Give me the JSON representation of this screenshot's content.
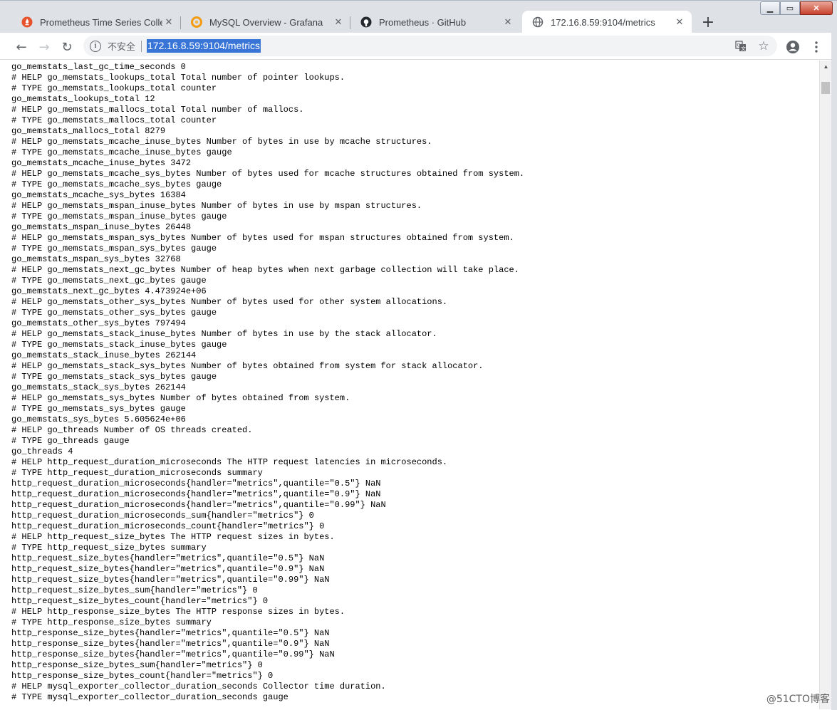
{
  "tabs": [
    {
      "title": "Prometheus Time Series Collec",
      "icon": "prometheus-flame-icon",
      "active": false
    },
    {
      "title": "MySQL Overview - Grafana",
      "icon": "grafana-icon",
      "active": false
    },
    {
      "title": "Prometheus · GitHub",
      "icon": "github-icon",
      "active": false
    },
    {
      "title": "172.16.8.59:9104/metrics",
      "icon": "globe-icon",
      "active": true
    }
  ],
  "new_tab_label": "+",
  "window_controls": {
    "minimize": "▁",
    "maximize": "▭",
    "close": "✕"
  },
  "toolbar": {
    "back": "←",
    "forward": "→",
    "reload": "↻",
    "info": "i",
    "insecure_label": "不安全",
    "url": "172.16.8.59:9104/metrics",
    "translate_icon": "translate-icon",
    "star_icon": "star-icon",
    "account_icon": "account-icon",
    "menu_icon": "menu-icon"
  },
  "metrics_lines": [
    "go_memstats_last_gc_time_seconds 0",
    "# HELP go_memstats_lookups_total Total number of pointer lookups.",
    "# TYPE go_memstats_lookups_total counter",
    "go_memstats_lookups_total 12",
    "# HELP go_memstats_mallocs_total Total number of mallocs.",
    "# TYPE go_memstats_mallocs_total counter",
    "go_memstats_mallocs_total 8279",
    "# HELP go_memstats_mcache_inuse_bytes Number of bytes in use by mcache structures.",
    "# TYPE go_memstats_mcache_inuse_bytes gauge",
    "go_memstats_mcache_inuse_bytes 3472",
    "# HELP go_memstats_mcache_sys_bytes Number of bytes used for mcache structures obtained from system.",
    "# TYPE go_memstats_mcache_sys_bytes gauge",
    "go_memstats_mcache_sys_bytes 16384",
    "# HELP go_memstats_mspan_inuse_bytes Number of bytes in use by mspan structures.",
    "# TYPE go_memstats_mspan_inuse_bytes gauge",
    "go_memstats_mspan_inuse_bytes 26448",
    "# HELP go_memstats_mspan_sys_bytes Number of bytes used for mspan structures obtained from system.",
    "# TYPE go_memstats_mspan_sys_bytes gauge",
    "go_memstats_mspan_sys_bytes 32768",
    "# HELP go_memstats_next_gc_bytes Number of heap bytes when next garbage collection will take place.",
    "# TYPE go_memstats_next_gc_bytes gauge",
    "go_memstats_next_gc_bytes 4.473924e+06",
    "# HELP go_memstats_other_sys_bytes Number of bytes used for other system allocations.",
    "# TYPE go_memstats_other_sys_bytes gauge",
    "go_memstats_other_sys_bytes 797494",
    "# HELP go_memstats_stack_inuse_bytes Number of bytes in use by the stack allocator.",
    "# TYPE go_memstats_stack_inuse_bytes gauge",
    "go_memstats_stack_inuse_bytes 262144",
    "# HELP go_memstats_stack_sys_bytes Number of bytes obtained from system for stack allocator.",
    "# TYPE go_memstats_stack_sys_bytes gauge",
    "go_memstats_stack_sys_bytes 262144",
    "# HELP go_memstats_sys_bytes Number of bytes obtained from system.",
    "# TYPE go_memstats_sys_bytes gauge",
    "go_memstats_sys_bytes 5.605624e+06",
    "# HELP go_threads Number of OS threads created.",
    "# TYPE go_threads gauge",
    "go_threads 4",
    "# HELP http_request_duration_microseconds The HTTP request latencies in microseconds.",
    "# TYPE http_request_duration_microseconds summary",
    "http_request_duration_microseconds{handler=\"metrics\",quantile=\"0.5\"} NaN",
    "http_request_duration_microseconds{handler=\"metrics\",quantile=\"0.9\"} NaN",
    "http_request_duration_microseconds{handler=\"metrics\",quantile=\"0.99\"} NaN",
    "http_request_duration_microseconds_sum{handler=\"metrics\"} 0",
    "http_request_duration_microseconds_count{handler=\"metrics\"} 0",
    "# HELP http_request_size_bytes The HTTP request sizes in bytes.",
    "# TYPE http_request_size_bytes summary",
    "http_request_size_bytes{handler=\"metrics\",quantile=\"0.5\"} NaN",
    "http_request_size_bytes{handler=\"metrics\",quantile=\"0.9\"} NaN",
    "http_request_size_bytes{handler=\"metrics\",quantile=\"0.99\"} NaN",
    "http_request_size_bytes_sum{handler=\"metrics\"} 0",
    "http_request_size_bytes_count{handler=\"metrics\"} 0",
    "# HELP http_response_size_bytes The HTTP response sizes in bytes.",
    "# TYPE http_response_size_bytes summary",
    "http_response_size_bytes{handler=\"metrics\",quantile=\"0.5\"} NaN",
    "http_response_size_bytes{handler=\"metrics\",quantile=\"0.9\"} NaN",
    "http_response_size_bytes{handler=\"metrics\",quantile=\"0.99\"} NaN",
    "http_response_size_bytes_sum{handler=\"metrics\"} 0",
    "http_response_size_bytes_count{handler=\"metrics\"} 0",
    "# HELP mysql_exporter_collector_duration_seconds Collector time duration.",
    "# TYPE mysql_exporter_collector_duration_seconds gauge"
  ],
  "watermark": "@51CTO博客",
  "colors": {
    "tabstrip": "#dee1e6",
    "url_highlight": "#3875d7",
    "prometheus": "#e6522c",
    "grafana": "#f39c12"
  }
}
